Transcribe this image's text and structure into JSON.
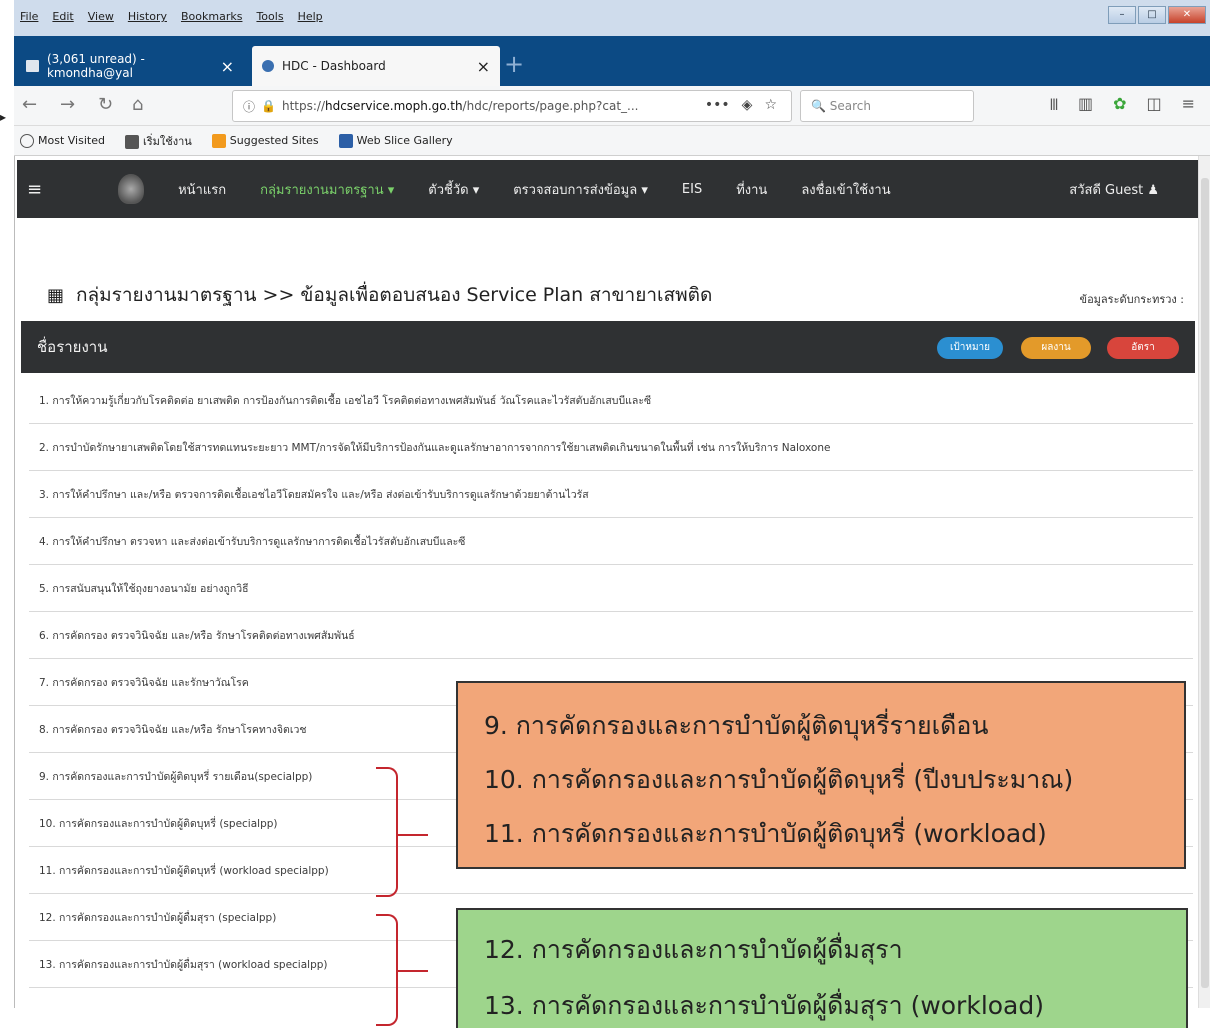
{
  "browser": {
    "menu": [
      "File",
      "Edit",
      "View",
      "History",
      "Bookmarks",
      "Tools",
      "Help"
    ],
    "tabs": [
      {
        "label": "(3,061 unread) - kmondha@yal",
        "active": false
      },
      {
        "label": "HDC - Dashboard",
        "active": true
      }
    ],
    "url_prefix": "https://",
    "url_domain": "hdcservice.moph.go.th",
    "url_path": "/hdc/reports/page.php?cat_...",
    "url_more": "•••",
    "search_placeholder": "Search",
    "bookmarks": [
      {
        "label": "Most Visited",
        "icon": "gear-icon"
      },
      {
        "label": "เริ่มใช้งาน",
        "icon": "book-icon"
      },
      {
        "label": "Suggested Sites",
        "icon": "ie-icon"
      },
      {
        "label": "Web Slice Gallery",
        "icon": "slice-icon"
      }
    ]
  },
  "site": {
    "nav": {
      "items": [
        {
          "label": "หน้าแรก",
          "active": false
        },
        {
          "label": "กลุ่มรายงานมาตรฐาน ▾",
          "active": true
        },
        {
          "label": "ตัวชี้วัด ▾",
          "active": false
        },
        {
          "label": "ตรวจสอบการส่งข้อมูล ▾",
          "active": false
        },
        {
          "label": "EIS",
          "active": false
        },
        {
          "label": "ที่งาน",
          "active": false
        },
        {
          "label": "ลงชื่อเข้าใช้งาน",
          "active": false
        }
      ],
      "user": "สวัสดี Guest ♟"
    },
    "page_title": "กลุ่มรายงานมาตรฐาน >> ข้อมูลเพื่อตอบสนอง Service Plan สาขายาเสพติด",
    "updated_label": "ข้อมูลระดับกระทรวง :",
    "report_header": "ชื่อรายงาน",
    "pills": {
      "target": "เป้าหมาย",
      "result": "ผลงาน",
      "rank": "อัตรา"
    },
    "reports": [
      "1. การให้ความรู้เกี่ยวกับโรคติดต่อ ยาเสพติด การป้องกันการติดเชื้อ เอชไอวี โรคติดต่อทางเพศสัมพันธ์ วัณโรคและไวรัสตับอักเสบบีและซี",
      "2. การบำบัดรักษายาเสพติดโดยใช้สารทดแทนระยะยาว MMT/การจัดให้มีบริการป้องกันและดูแลรักษาอาการจากการใช้ยาเสพติดเกินขนาดในพื้นที่ เช่น การให้บริการ Naloxone",
      "3. การให้คำปรึกษา และ/หรือ ตรวจการติดเชื้อเอชไอวีโดยสมัครใจ และ/หรือ ส่งต่อเข้ารับบริการดูแลรักษาด้วยยาต้านไวรัส",
      "4. การให้คำปรึกษา ตรวจหา และส่งต่อเข้ารับบริการดูแลรักษาการติดเชื้อไวรัสตับอักเสบบีและซี",
      "5. การสนับสนุนให้ใช้ถุงยางอนามัย อย่างถูกวิธี",
      "6. การคัดกรอง ตรวจวินิจฉัย และ/หรือ รักษาโรคติดต่อทางเพศสัมพันธ์",
      "7. การคัดกรอง ตรวจวินิจฉัย และรักษาวัณโรค",
      "8. การคัดกรอง ตรวจวินิจฉัย และ/หรือ รักษาโรคทางจิตเวช",
      "9. การคัดกรองและการบำบัดผู้ติดบุหรี่ รายเดือน(specialpp)",
      "10. การคัดกรองและการบำบัดผู้ติดบุหรี่ (specialpp)",
      "11. การคัดกรองและการบำบัดผู้ติดบุหรี่ (workload specialpp)",
      "12. การคัดกรองและการบำบัดผู้ดื่มสุรา (specialpp)",
      "13. การคัดกรองและการบำบัดผู้ดื่มสุรา (workload specialpp)"
    ]
  },
  "annotations": {
    "orange_box": [
      "9. การคัดกรองและการบำบัดผู้ติดบุหรี่รายเดือน",
      "10. การคัดกรองและการบำบัดผู้ติดบุหรี่ (ปีงบประมาณ)",
      "11. การคัดกรองและการบำบัดผู้ติดบุหรี่ (workload)"
    ],
    "green_box": [
      "12. การคัดกรองและการบำบัดผู้ดื่มสุรา",
      "13. การคัดกรองและการบำบัดผู้ดื่มสุรา (workload)"
    ]
  },
  "colors": {
    "nav_bg": "#2f3133",
    "active_nav": "#7ad06a",
    "orange_box": "#f2a679",
    "green_box": "#9ed58c",
    "brace": "#c4262e"
  }
}
